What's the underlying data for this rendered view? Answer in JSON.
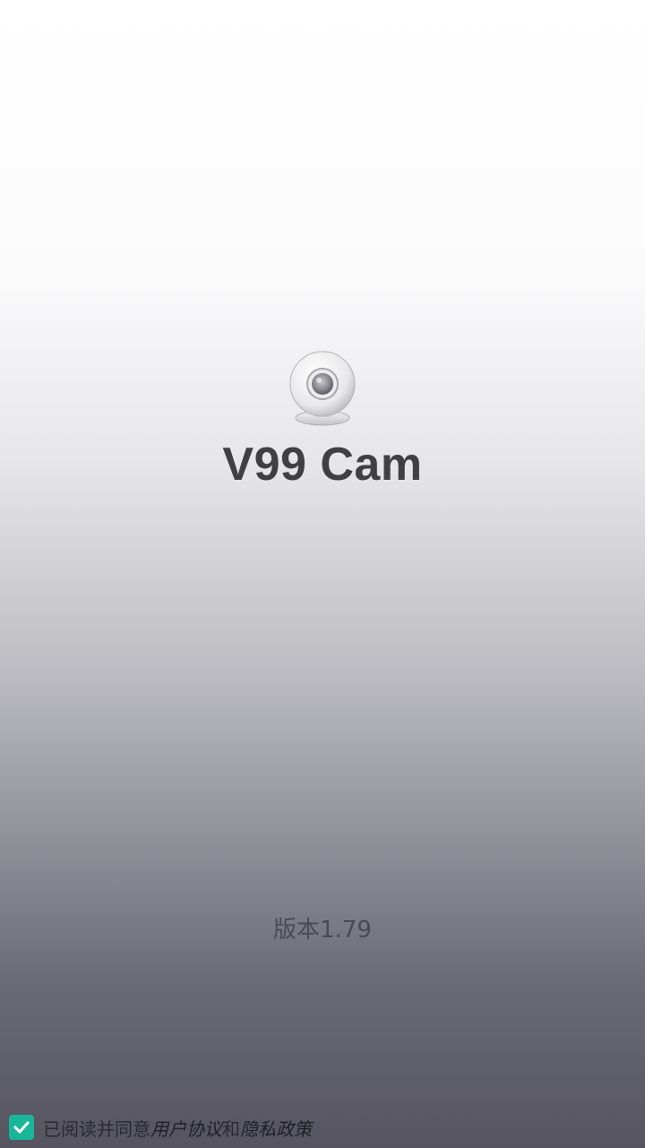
{
  "app": {
    "name": "V99 Cam",
    "version": "版本1.79"
  },
  "logo": {
    "icon": "webcam-icon"
  },
  "agreement": {
    "checked": true,
    "prefix": "已阅读并同意",
    "user_agreement": "用户协议",
    "conjunction": "和",
    "privacy_policy": "隐私政策",
    "accent_color": "#1ab69a"
  },
  "colors": {
    "title": "#3f3f44",
    "background_top": "#ffffff",
    "background_bottom": "#55545f"
  }
}
